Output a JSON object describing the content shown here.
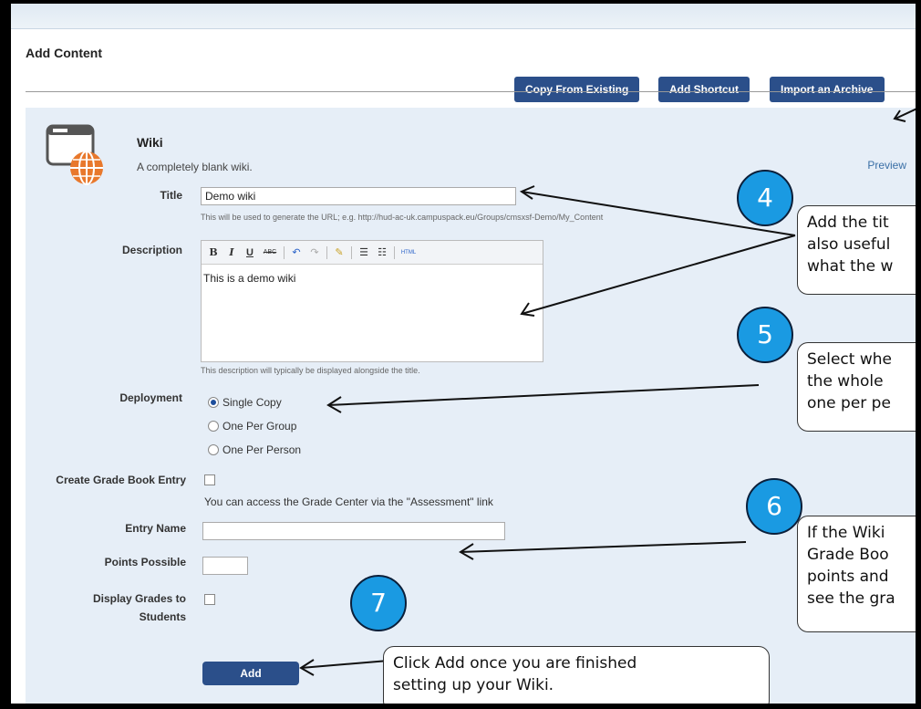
{
  "header": {
    "title": "Add Content",
    "buttons": {
      "copy": "Copy From Existing",
      "shortcut": "Add Shortcut",
      "import": "Import an Archive"
    }
  },
  "tool": {
    "title": "Wiki",
    "description": "A completely blank wiki.",
    "preview": "Preview"
  },
  "form": {
    "title_label": "Title",
    "title_value": "Demo wiki",
    "title_hint": "This will be used to generate the URL; e.g. http://hud-ac-uk.campuspack.eu/Groups/cmsxsf-Demo/My_Content",
    "description_label": "Description",
    "description_value": "This is a demo wiki",
    "description_hint": "This description will typically be displayed alongside the title.",
    "deployment_label": "Deployment",
    "deployment_options": [
      "Single Copy",
      "One Per Group",
      "One Per Person"
    ],
    "deployment_selected": "Single Copy",
    "gradebook_label": "Create Grade Book Entry",
    "gradebook_hint": "You can access the Grade Center via the \"Assessment\" link",
    "entry_name_label": "Entry Name",
    "entry_name_value": "",
    "points_label": "Points Possible",
    "points_value": "",
    "display_grades_label_1": "Display Grades to",
    "display_grades_label_2": "Students",
    "submit_label": "Add"
  },
  "editor_toolbar": {
    "bold": "B",
    "italic": "I",
    "underline": "U",
    "strike": "ABC",
    "html": "HTML"
  },
  "callouts": {
    "c4": {
      "number": "4",
      "lines": [
        "Add the tit",
        "also useful",
        "what the w"
      ]
    },
    "c5": {
      "number": "5",
      "lines": [
        "Select whe",
        "the whole",
        "one per pe"
      ]
    },
    "c6": {
      "number": "6",
      "lines": [
        "If the Wiki",
        "Grade Boo",
        "points and",
        "see the gra"
      ]
    },
    "c7": {
      "number": "7",
      "lines": [
        "Click Add once you are finished",
        "setting up your Wiki."
      ]
    }
  },
  "colors": {
    "button_blue": "#2b4f8a",
    "panel_bg": "#e6eef7",
    "badge_blue": "#1a9ae2"
  }
}
